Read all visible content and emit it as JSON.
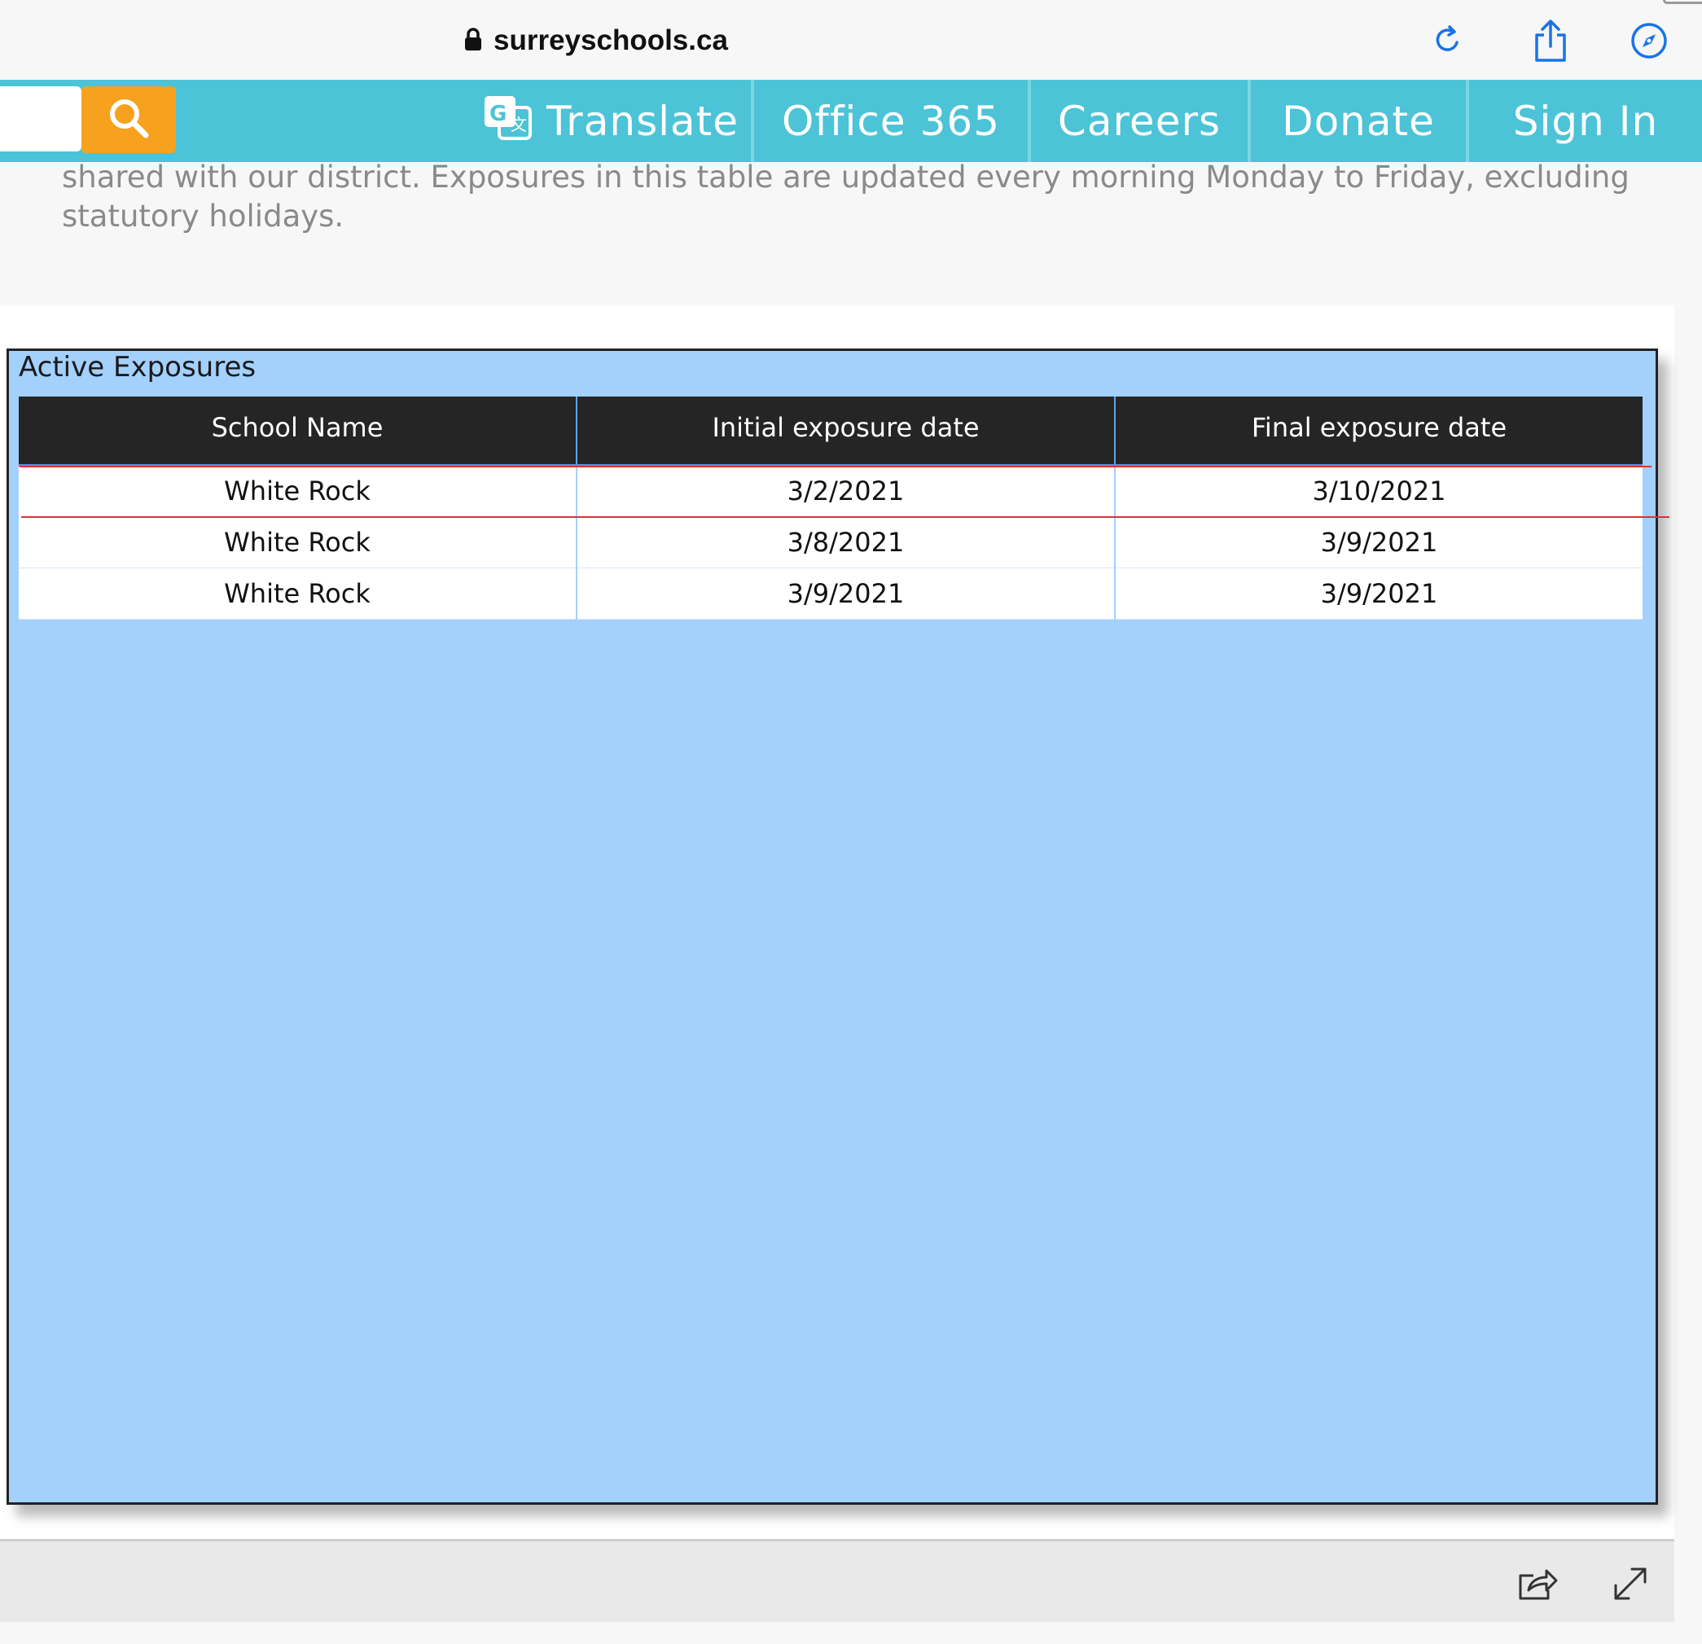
{
  "browser": {
    "url": "surreyschools.ca",
    "icons": [
      "lock-icon",
      "reload-icon",
      "share-icon",
      "compass-icon"
    ],
    "accent_color": "#1a73e8"
  },
  "nav": {
    "search_placeholder": "",
    "items": [
      {
        "label": "Translate"
      },
      {
        "label": "Office 365"
      },
      {
        "label": "Careers"
      },
      {
        "label": "Donate"
      },
      {
        "label": "Sign In"
      }
    ],
    "bg_color": "#4cc3d6",
    "search_button_color": "#f6a21e"
  },
  "intro": {
    "text": "shared with our district. Exposures in this table are updated every morning Monday to Friday, excluding statutory holidays."
  },
  "report": {
    "title": "Active Exposures",
    "columns": [
      "School Name",
      "Initial exposure date",
      "Final exposure date"
    ],
    "rows": [
      [
        "White Rock",
        "3/2/2021",
        "3/10/2021"
      ],
      [
        "White Rock",
        "3/8/2021",
        "3/9/2021"
      ],
      [
        "White Rock",
        "3/9/2021",
        "3/9/2021"
      ]
    ],
    "background_color": "#a3d0fd",
    "header_color": "#252525"
  },
  "toolbar": {
    "icons": [
      "share-report-icon",
      "expand-icon"
    ]
  }
}
